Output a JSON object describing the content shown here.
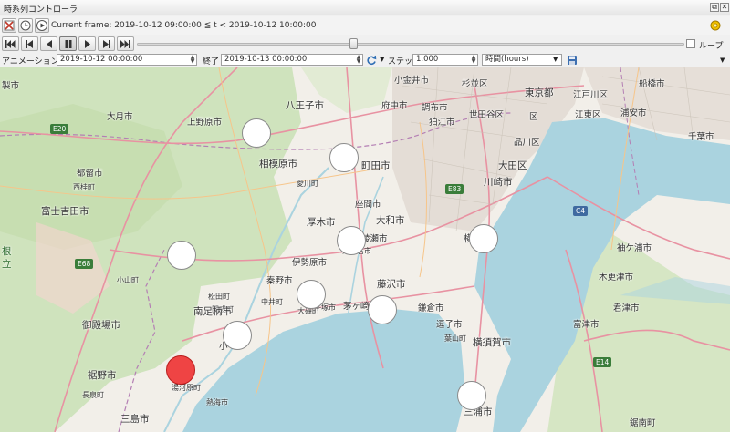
{
  "window": {
    "title": "時系列コントローラ",
    "close_label": "✕",
    "dock_label": "⧉"
  },
  "toolbar": {
    "current_frame_text": "Current frame: 2019-10-12 09:00:00 ≦ t < 2019-10-12 10:00:00",
    "loop_label": "ループ",
    "loop_checked": false,
    "slider_position_fraction": 0.395
  },
  "range": {
    "animation_range_label": "アニメーション範囲",
    "start_value": "2019-10-12 00:00:00",
    "end_label": "終了",
    "end_value": "2019-10-13 00:00:00",
    "step_label": "ステップ",
    "step_value": "1.000",
    "unit_value": "時間(hours)"
  },
  "map": {
    "labels": [
      {
        "text": "大月市",
        "name": "map-label-otsuki"
      },
      {
        "text": "上野原市",
        "name": "map-label-uenohara"
      },
      {
        "text": "八王子市",
        "name": "map-label-hachioji"
      },
      {
        "text": "府中市",
        "name": "map-label-fuchu"
      },
      {
        "text": "調布市",
        "name": "map-label-chofu"
      },
      {
        "text": "小金井市",
        "name": "map-label-koganei"
      },
      {
        "text": "杉並区",
        "name": "map-label-suginami"
      },
      {
        "text": "東京都",
        "name": "map-label-tokyo"
      },
      {
        "text": "江戸川区",
        "name": "map-label-edogawa"
      },
      {
        "text": "船橋市",
        "name": "map-label-funabashi"
      },
      {
        "text": "狛江市",
        "name": "map-label-komae"
      },
      {
        "text": "世田谷区",
        "name": "map-label-setagaya"
      },
      {
        "text": "区",
        "name": "map-label-ku"
      },
      {
        "text": "江東区",
        "name": "map-label-koto"
      },
      {
        "text": "浦安市",
        "name": "map-label-urayasu"
      },
      {
        "text": "品川区",
        "name": "map-label-shinagawa"
      },
      {
        "text": "千葉市",
        "name": "map-label-chiba"
      },
      {
        "text": "都留市",
        "name": "map-label-tsuru"
      },
      {
        "text": "相模原市",
        "name": "map-label-sagamihara"
      },
      {
        "text": "町田市",
        "name": "map-label-machida"
      },
      {
        "text": "大田区",
        "name": "map-label-ota"
      },
      {
        "text": "川崎市",
        "name": "map-label-kawasaki"
      },
      {
        "text": "西桂町",
        "name": "map-label-nishikatsura"
      },
      {
        "text": "愛川町",
        "name": "map-label-aikawa"
      },
      {
        "text": "富士吉田市",
        "name": "map-label-fujiyoshida"
      },
      {
        "text": "座間市",
        "name": "map-label-zama"
      },
      {
        "text": "厚木市",
        "name": "map-label-atsugi"
      },
      {
        "text": "大和市",
        "name": "map-label-yamato"
      },
      {
        "text": "横",
        "name": "map-label-yoko"
      },
      {
        "text": "袖ケ浦市",
        "name": "map-label-sodegaura"
      },
      {
        "text": "根",
        "name": "map-label-ne"
      },
      {
        "text": "立",
        "name": "map-label-ritsu"
      },
      {
        "text": "綾瀬市",
        "name": "map-label-ayase"
      },
      {
        "text": "秦野市",
        "name": "map-label-hadano"
      },
      {
        "text": "伊勢原市",
        "name": "map-label-isehara"
      },
      {
        "text": "海老名市",
        "name": "map-label-ebina"
      },
      {
        "text": "藤沢市",
        "name": "map-label-fujisawa"
      },
      {
        "text": "木更津市",
        "name": "map-label-kisarazu"
      },
      {
        "text": "小山町",
        "name": "map-label-oyama"
      },
      {
        "text": "松田町",
        "name": "map-label-matsuda"
      },
      {
        "text": "中井町",
        "name": "map-label-nakai"
      },
      {
        "text": "平塚市",
        "name": "map-label-hiratsuka"
      },
      {
        "text": "君津市",
        "name": "map-label-kimitsu"
      },
      {
        "text": "開成町",
        "name": "map-label-kaisei"
      },
      {
        "text": "南足柄市",
        "name": "map-label-minamiashigara"
      },
      {
        "text": "大磯町",
        "name": "map-label-oiso"
      },
      {
        "text": "茅ヶ崎",
        "name": "map-label-chigasaki"
      },
      {
        "text": "鎌倉市",
        "name": "map-label-kamakura"
      },
      {
        "text": "逗子市",
        "name": "map-label-zushi"
      },
      {
        "text": "富津市",
        "name": "map-label-futtsu"
      },
      {
        "text": "御殿場市",
        "name": "map-label-gotemba"
      },
      {
        "text": "小",
        "name": "map-label-o"
      },
      {
        "text": "葉山町",
        "name": "map-label-hayama"
      },
      {
        "text": "横須賀市",
        "name": "map-label-yokosuka"
      },
      {
        "text": "裾野市",
        "name": "map-label-susono"
      },
      {
        "text": "長泉町",
        "name": "map-label-nagaizumi"
      },
      {
        "text": "湯河原町",
        "name": "map-label-yugawara"
      },
      {
        "text": "熱海市",
        "name": "map-label-atami"
      },
      {
        "text": "三浦市",
        "name": "map-label-miura"
      },
      {
        "text": "三島市",
        "name": "map-label-mishima"
      },
      {
        "text": "製市",
        "name": "map-label-seishi"
      },
      {
        "text": "鋸南町",
        "name": "map-label-kyonan"
      }
    ],
    "road_badges": [
      {
        "text": "E20",
        "name": "road-badge-e20"
      },
      {
        "text": "E68",
        "name": "road-badge-e68"
      },
      {
        "text": "E83",
        "name": "road-badge-e83"
      },
      {
        "text": "C4",
        "name": "road-badge-c4"
      },
      {
        "text": "E14",
        "name": "road-badge-e14"
      }
    ],
    "points": [
      {
        "name": "marker-1",
        "active": false
      },
      {
        "name": "marker-2",
        "active": false
      },
      {
        "name": "marker-3",
        "active": false
      },
      {
        "name": "marker-4",
        "active": false
      },
      {
        "name": "marker-5",
        "active": false
      },
      {
        "name": "marker-6",
        "active": false
      },
      {
        "name": "marker-7",
        "active": false
      },
      {
        "name": "marker-8",
        "active": false
      },
      {
        "name": "marker-9",
        "active": false
      },
      {
        "name": "marker-10",
        "active": true
      },
      {
        "name": "marker-11",
        "active": false
      }
    ]
  },
  "colors": {
    "active_marker": "#ef4444",
    "inactive_marker": "#ffffff",
    "sea": "#aad3df",
    "land": "#f2efe9",
    "forest": "#cfe3bd"
  }
}
